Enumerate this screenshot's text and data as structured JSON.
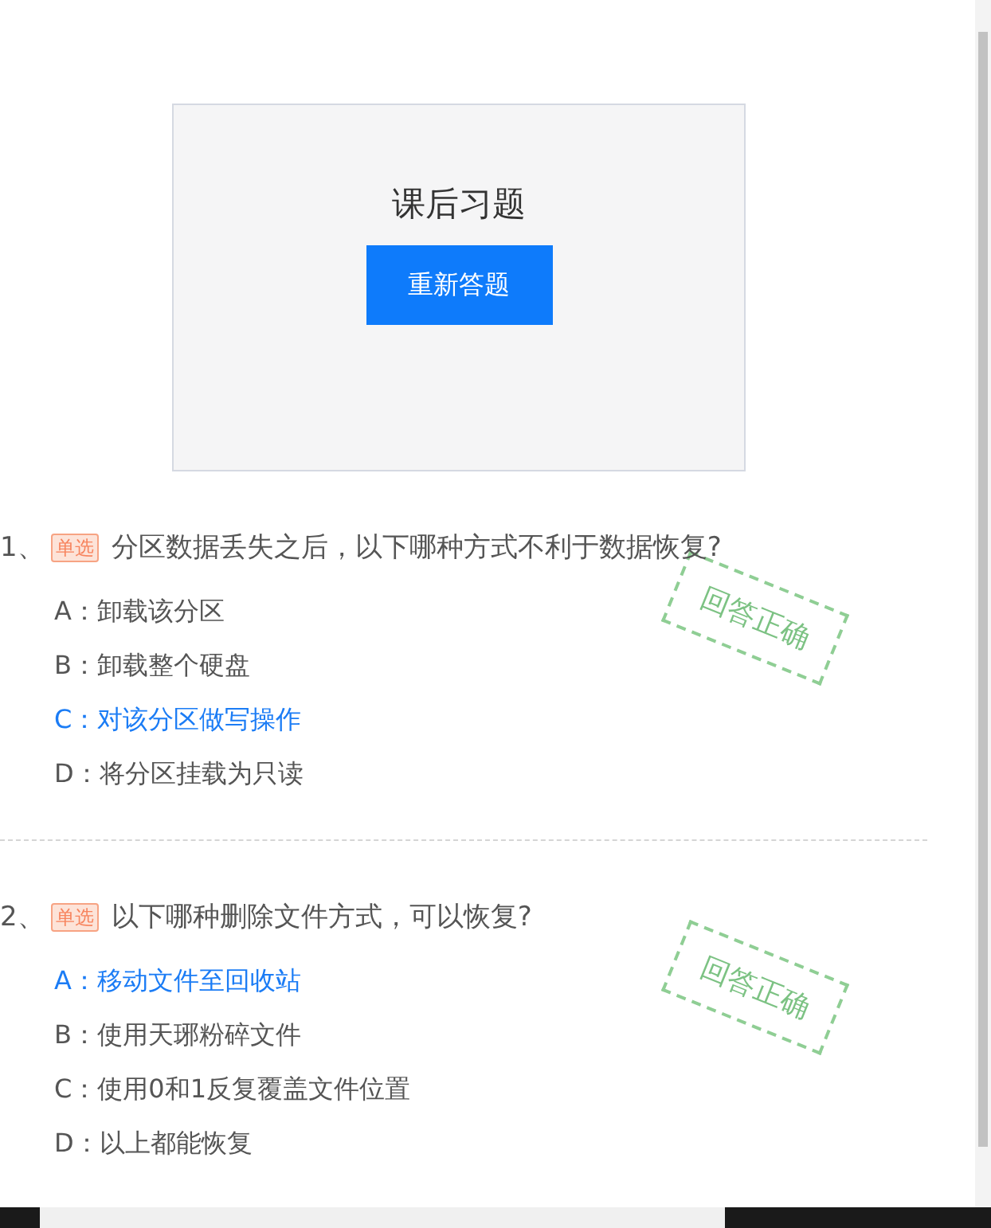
{
  "card": {
    "title": "课后习题",
    "button": "重新答题"
  },
  "questions": [
    {
      "number": "1、",
      "tag": "单选",
      "text": "分区数据丢失之后，以下哪种方式不利于数据恢复?",
      "stamp": "回答正确",
      "options": [
        {
          "letter": "A：",
          "text": "卸载该分区",
          "selected": false
        },
        {
          "letter": "B：",
          "text": "卸载整个硬盘",
          "selected": false
        },
        {
          "letter": "C：",
          "text": "对该分区做写操作",
          "selected": true
        },
        {
          "letter": "D：",
          "text": "将分区挂载为只读",
          "selected": false
        }
      ]
    },
    {
      "number": "2、",
      "tag": "单选",
      "text": "以下哪种删除文件方式，可以恢复?",
      "stamp": "回答正确",
      "options": [
        {
          "letter": "A：",
          "text": "移动文件至回收站",
          "selected": true
        },
        {
          "letter": "B：",
          "text": "使用天琊粉碎文件",
          "selected": false
        },
        {
          "letter": "C：",
          "text": "使用0和1反复覆盖文件位置",
          "selected": false
        },
        {
          "letter": "D：",
          "text": "以上都能恢复",
          "selected": false
        }
      ]
    }
  ]
}
